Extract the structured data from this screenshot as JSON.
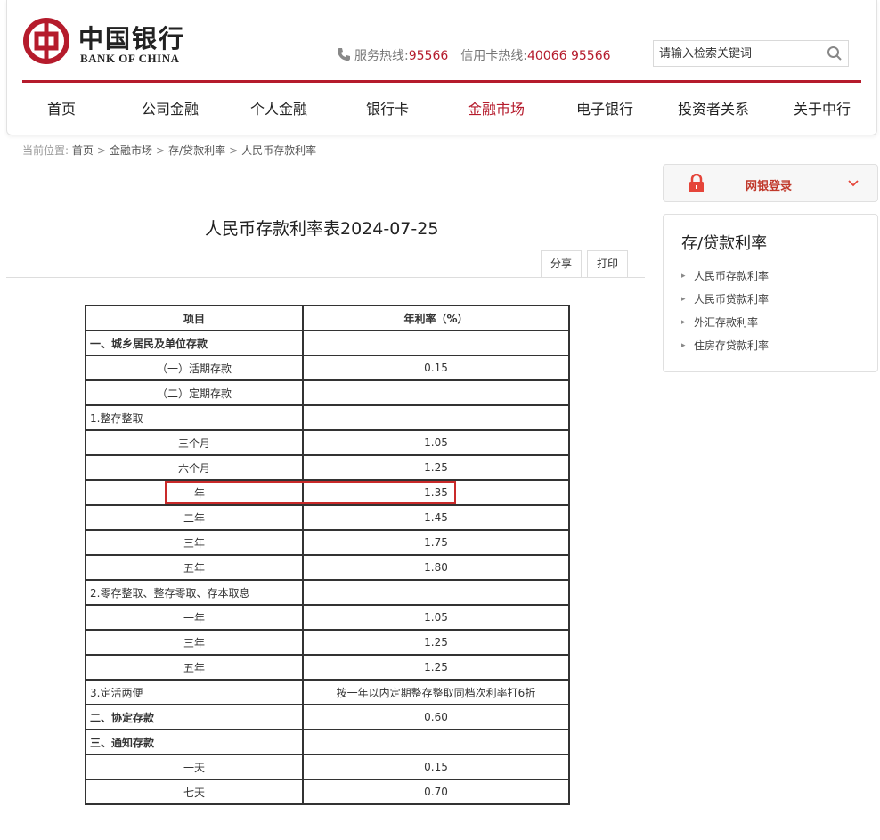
{
  "header": {
    "logo_cn": "中国银行",
    "logo_en": "BANK OF CHINA",
    "service_hotline_label": "服务热线:",
    "service_hotline_number": "95566",
    "credit_hotline_label": "信用卡热线:",
    "credit_hotline_number": "40066 95566",
    "search_placeholder": "请输入检索关键词",
    "brand_color": "#b51b2c"
  },
  "nav": {
    "items": [
      "首页",
      "公司金融",
      "个人金融",
      "银行卡",
      "金融市场",
      "电子银行",
      "投资者关系",
      "关于中行"
    ],
    "active": "金融市场"
  },
  "breadcrumb": {
    "prefix": "当前位置:",
    "items": [
      "首页",
      "金融市场",
      "存/贷款利率",
      "人民币存款利率"
    ]
  },
  "main": {
    "title": "人民币存款利率表2024-07-25",
    "share_label": "分享",
    "print_label": "打印"
  },
  "table": {
    "headers": [
      "项目",
      "年利率（%）"
    ],
    "rows": [
      {
        "item": "一、城乡居民及单位存款",
        "rate": "",
        "style": "bold"
      },
      {
        "item": "（一）活期存款",
        "rate": "0.15",
        "style": "center"
      },
      {
        "item": "（二）定期存款",
        "rate": "",
        "style": "center"
      },
      {
        "item": "1.整存整取",
        "rate": "",
        "style": "left"
      },
      {
        "item": "三个月",
        "rate": "1.05",
        "style": "center"
      },
      {
        "item": "六个月",
        "rate": "1.25",
        "style": "center"
      },
      {
        "item": "一年",
        "rate": "1.35",
        "style": "center"
      },
      {
        "item": "二年",
        "rate": "1.45",
        "style": "center"
      },
      {
        "item": "三年",
        "rate": "1.75",
        "style": "center"
      },
      {
        "item": "五年",
        "rate": "1.80",
        "style": "center"
      },
      {
        "item": "2.零存整取、整存零取、存本取息",
        "rate": "",
        "style": "left"
      },
      {
        "item": "一年",
        "rate": "1.05",
        "style": "center"
      },
      {
        "item": "三年",
        "rate": "1.25",
        "style": "center"
      },
      {
        "item": "五年",
        "rate": "1.25",
        "style": "center"
      },
      {
        "item": "3.定活两便",
        "rate": "按一年以内定期整存整取同档次利率打6折",
        "style": "left"
      },
      {
        "item": "二、协定存款",
        "rate": "0.60",
        "style": "bold"
      },
      {
        "item": "三、通知存款",
        "rate": "",
        "style": "bold"
      },
      {
        "item": "一天",
        "rate": "0.15",
        "style": "center"
      },
      {
        "item": "七天",
        "rate": "0.70",
        "style": "center"
      }
    ],
    "highlight_color": "#c92a2a"
  },
  "sidebar": {
    "login_label": "网银登录",
    "section_title": "存/贷款利率",
    "links": [
      "人民币存款利率",
      "人民币贷款利率",
      "外汇存款利率",
      "住房存贷款利率"
    ]
  }
}
